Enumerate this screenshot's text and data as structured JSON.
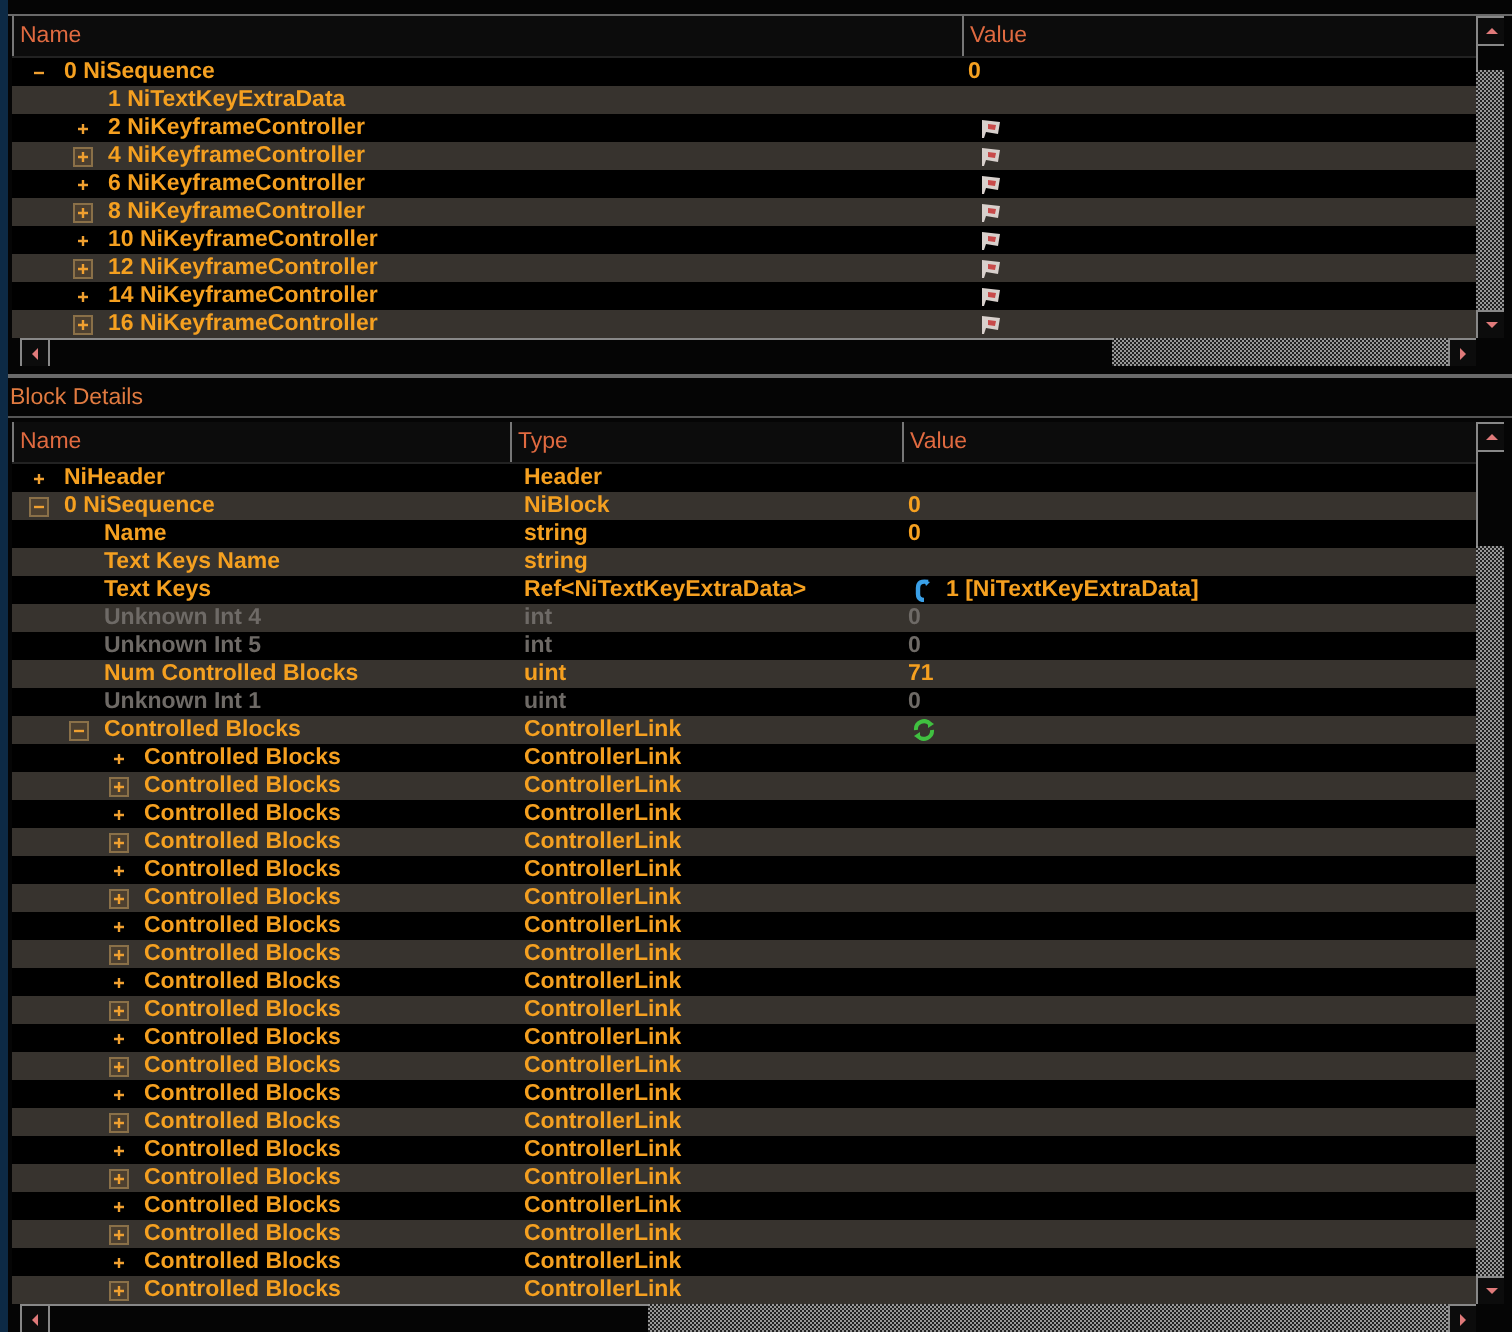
{
  "top_panel": {
    "columns": [
      "Name",
      "Value"
    ],
    "tree": [
      {
        "name": "0 NiSequence",
        "value": "0",
        "expanded": true,
        "disabled": false,
        "children": [
          {
            "name": "1 NiTextKeyExtraData",
            "disabled": false
          },
          {
            "name": "2 NiKeyframeController",
            "kind": "controller",
            "expanded": false,
            "disabled": false
          },
          {
            "name": "4 NiKeyframeController",
            "kind": "controller",
            "expanded": false,
            "disabled": false
          },
          {
            "name": "6 NiKeyframeController",
            "kind": "controller",
            "expanded": false,
            "disabled": false
          },
          {
            "name": "8 NiKeyframeController",
            "kind": "controller",
            "expanded": false,
            "disabled": false
          },
          {
            "name": "10 NiKeyframeController",
            "kind": "controller",
            "expanded": false,
            "disabled": false
          },
          {
            "name": "12 NiKeyframeController",
            "kind": "controller",
            "expanded": false,
            "disabled": false
          },
          {
            "name": "14 NiKeyframeController",
            "kind": "controller",
            "expanded": false,
            "disabled": false
          },
          {
            "name": "16 NiKeyframeController",
            "kind": "controller",
            "expanded": false,
            "disabled": false
          }
        ]
      }
    ]
  },
  "block_details": {
    "title": "Block Details",
    "columns": [
      "Name",
      "Type",
      "Value"
    ],
    "tree": [
      {
        "name": "NiHeader",
        "type": "Header",
        "expanded": false,
        "disabled": false
      },
      {
        "name": "0 NiSequence",
        "type": "NiBlock",
        "value": "0",
        "expanded": true,
        "disabled": false,
        "children": [
          {
            "name": "Name",
            "type": "string",
            "value": "0",
            "disabled": false
          },
          {
            "name": "Text Keys Name",
            "type": "string",
            "disabled": false
          },
          {
            "name": "Text Keys",
            "type": "Ref<NiTextKeyExtraData>",
            "value": "1 [NiTextKeyExtraData]",
            "kind": "ref",
            "disabled": false
          },
          {
            "name": "Unknown Int 4",
            "type": "int",
            "value": "0",
            "disabled": true
          },
          {
            "name": "Unknown Int 5",
            "type": "int",
            "value": "0",
            "disabled": true
          },
          {
            "name": "Num Controlled Blocks",
            "type": "uint",
            "value": "71",
            "disabled": false
          },
          {
            "name": "Unknown Int 1",
            "type": "uint",
            "value": "0",
            "disabled": true
          },
          {
            "name": "Controlled Blocks",
            "type": "ControllerLink",
            "kind": "array",
            "expanded": true,
            "disabled": false,
            "children": [
              {
                "name": "Controlled Blocks",
                "type": "ControllerLink",
                "expanded": false,
                "disabled": false
              },
              {
                "name": "Controlled Blocks",
                "type": "ControllerLink",
                "expanded": false,
                "disabled": false
              },
              {
                "name": "Controlled Blocks",
                "type": "ControllerLink",
                "expanded": false,
                "disabled": false
              },
              {
                "name": "Controlled Blocks",
                "type": "ControllerLink",
                "expanded": false,
                "disabled": false
              },
              {
                "name": "Controlled Blocks",
                "type": "ControllerLink",
                "expanded": false,
                "disabled": false
              },
              {
                "name": "Controlled Blocks",
                "type": "ControllerLink",
                "expanded": false,
                "disabled": false
              },
              {
                "name": "Controlled Blocks",
                "type": "ControllerLink",
                "expanded": false,
                "disabled": false
              },
              {
                "name": "Controlled Blocks",
                "type": "ControllerLink",
                "expanded": false,
                "disabled": false
              },
              {
                "name": "Controlled Blocks",
                "type": "ControllerLink",
                "expanded": false,
                "disabled": false
              },
              {
                "name": "Controlled Blocks",
                "type": "ControllerLink",
                "expanded": false,
                "disabled": false
              },
              {
                "name": "Controlled Blocks",
                "type": "ControllerLink",
                "expanded": false,
                "disabled": false
              },
              {
                "name": "Controlled Blocks",
                "type": "ControllerLink",
                "expanded": false,
                "disabled": false
              },
              {
                "name": "Controlled Blocks",
                "type": "ControllerLink",
                "expanded": false,
                "disabled": false
              },
              {
                "name": "Controlled Blocks",
                "type": "ControllerLink",
                "expanded": false,
                "disabled": false
              },
              {
                "name": "Controlled Blocks",
                "type": "ControllerLink",
                "expanded": false,
                "disabled": false
              },
              {
                "name": "Controlled Blocks",
                "type": "ControllerLink",
                "expanded": false,
                "disabled": false
              },
              {
                "name": "Controlled Blocks",
                "type": "ControllerLink",
                "expanded": false,
                "disabled": false
              },
              {
                "name": "Controlled Blocks",
                "type": "ControllerLink",
                "expanded": false,
                "disabled": false
              },
              {
                "name": "Controlled Blocks",
                "type": "ControllerLink",
                "expanded": false,
                "disabled": false
              },
              {
                "name": "Controlled Blocks",
                "type": "ControllerLink",
                "expanded": false,
                "disabled": false
              }
            ]
          }
        ]
      }
    ]
  }
}
